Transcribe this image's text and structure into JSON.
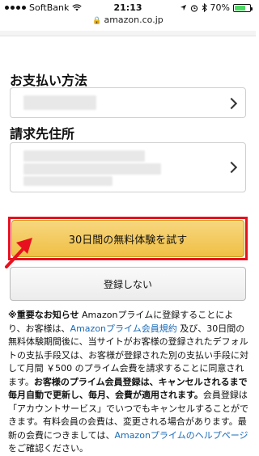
{
  "status_bar": {
    "carrier": "SoftBank",
    "time": "21:13",
    "battery": "70%",
    "battery_level": 0.7
  },
  "url_bar": {
    "domain": "amazon.co.jp"
  },
  "payment": {
    "label": "お支払い方法"
  },
  "billing": {
    "label": "請求先住所"
  },
  "buttons": {
    "start_trial": "30日間の無料体験を試す",
    "decline": "登録しない"
  },
  "notice": {
    "heading": "※重要なお知らせ",
    "t1": " Amazonプライムに登録することにより、お客様は、",
    "link1": "Amazonプライム会員規約",
    "t2": " 及び、30日間の無料体験期間後に、当サイトがお客様の登録されたデフォルトの支払手段又は、お客様が登録された別の支払い手段に対して月間 ￥500 のプライム会費を請求することに同意されます。",
    "bold1": "お客様のプライム会員登録は、キャンセルされるまで毎月自動で更新し、毎月、会費が適用されます。",
    "t3": "会員登録は「アカウントサービス」でいつでもキャンセルすることができます。有料会員の会費は、変更される場合があります。最新の会費につきましては、",
    "link2": "Amazonプライムのヘルプページ",
    "t4": " をご確認ください。"
  },
  "colors": {
    "primary_button": "#f0c14b",
    "highlight": "#e8101f",
    "link": "#1a6bb8"
  }
}
